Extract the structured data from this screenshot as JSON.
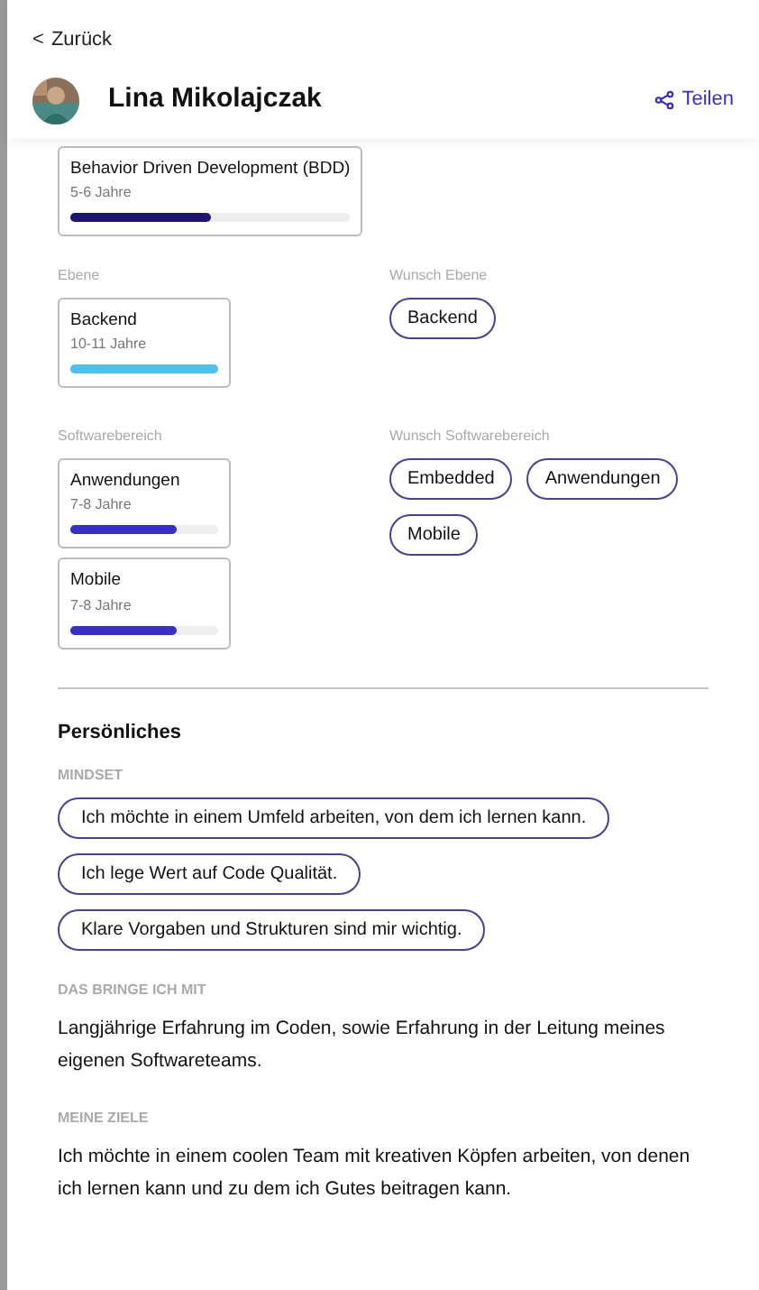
{
  "back_link": {
    "icon": "<",
    "label": "Zurück"
  },
  "profile": {
    "name": "Lina Mikolajczak",
    "share": {
      "label": "Teilen"
    }
  },
  "skills": {
    "cards": [
      {
        "title": "Behavior Driven Development (BDD)",
        "years": "5-6 Jahre",
        "level": 0.5,
        "color": "#1e1572"
      }
    ]
  },
  "rows": [
    {
      "label": "Ebene",
      "cards": [
        {
          "title": "Backend",
          "years": "10-11 Jahre",
          "level": 1.0,
          "color": "#4cc0ee"
        }
      ],
      "wish_label": "Wunsch Ebene",
      "wishes": [
        "Backend"
      ]
    },
    {
      "label": "Softwarebereich",
      "cards": [
        {
          "title": "Anwendungen",
          "years": "7-8 Jahre",
          "level": 0.72,
          "color": "#3a2fc4"
        },
        {
          "title": "Mobile",
          "years": "7-8 Jahre",
          "level": 0.72,
          "color": "#3a2fc4"
        }
      ],
      "wish_label": "Wunsch Softwarebereich",
      "wishes": [
        "Embedded",
        "Anwendungen",
        "Mobile"
      ]
    }
  ],
  "personal": {
    "title": "Persönliches",
    "mindset_label": "MINDSET",
    "mindset": [
      "Ich möchte in einem Umfeld arbeiten, von dem ich lernen kann.",
      "Ich lege Wert auf Code Qualität.",
      "Klare Vorgaben und Strukturen sind mir wichtig."
    ],
    "sections": [
      {
        "label": "DAS BRINGE ICH MIT",
        "text": "Langjährige Erfahrung im Coden, sowie Erfahrung in der Leitung meines eigenen Softwareteams."
      },
      {
        "label": "MEINE ZIELE",
        "text": "Ich möchte in einem coolen Team mit kreativen Köpfen arbeiten, von denen ich lernen kann und zu dem ich Gutes beitragen kann."
      }
    ]
  }
}
